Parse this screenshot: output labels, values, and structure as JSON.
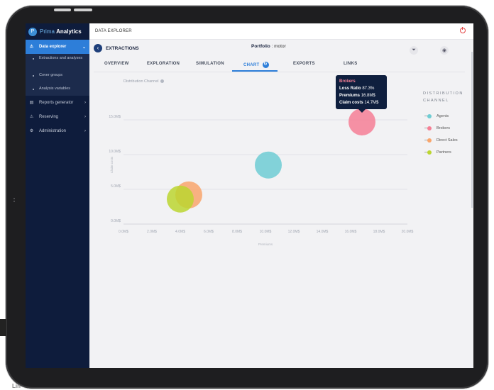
{
  "app": {
    "logo_letter": "P",
    "brand_light": "Prima",
    "brand_bold": "Analytics"
  },
  "sidebar": {
    "items": [
      {
        "label": "Data explorer",
        "icon": "warning-icon",
        "active": true
      },
      {
        "label": "Reports generator",
        "icon": "report-icon"
      },
      {
        "label": "Reserving",
        "icon": "warning-icon"
      },
      {
        "label": "Administration",
        "icon": "gear-icon"
      }
    ],
    "sub_items": [
      "Extractions and analyses",
      "Cover groups",
      "Analysis variables"
    ]
  },
  "topbar": {
    "title": "DATA EXPLORER"
  },
  "header": {
    "section": "EXTRACTIONS",
    "portfolio_label": "Portfolio",
    "portfolio_value": ": motor"
  },
  "tabs": [
    "OVERVIEW",
    "EXPLORATION",
    "SIMULATION",
    "CHART",
    "EXPORTS",
    "LINKS"
  ],
  "active_tab": "CHART",
  "chart_control": {
    "label": "Distribution Channel"
  },
  "tooltip": {
    "title": "Brokers",
    "loss_ratio_label": "Loss Ratio",
    "loss_ratio_value": "87.3%",
    "premiums_label": "Premiums",
    "premiums_value": "16.8M$",
    "claims_label": "Claim costs",
    "claims_value": "14.7M$"
  },
  "chart_data": {
    "type": "scatter",
    "xlabel": "Premiums",
    "ylabel": "Claim costs",
    "xlim": [
      0,
      20
    ],
    "ylim": [
      0,
      15
    ],
    "x_ticks": [
      "0.0M$",
      "2.0M$",
      "4.0M$",
      "6.0M$",
      "8.0M$",
      "10.0M$",
      "12.0M$",
      "14.0M$",
      "16.0M$",
      "18.0M$",
      "20.0M$"
    ],
    "y_ticks": [
      "0.0M$",
      "5.0M$",
      "10.0M$",
      "15.0M$"
    ],
    "legend_title": "DISTRIBUTION CHANNEL",
    "legend_position": "right",
    "series": [
      {
        "name": "Agents",
        "color": "#6fcdd3",
        "x": 10.2,
        "y": 8.5
      },
      {
        "name": "Brokers",
        "color": "#f67f95",
        "x": 16.8,
        "y": 14.7
      },
      {
        "name": "Direct Sales",
        "color": "#f9a66c",
        "x": 4.6,
        "y": 4.2
      },
      {
        "name": "Partners",
        "color": "#bcd630",
        "x": 4.0,
        "y": 3.6
      }
    ]
  }
}
